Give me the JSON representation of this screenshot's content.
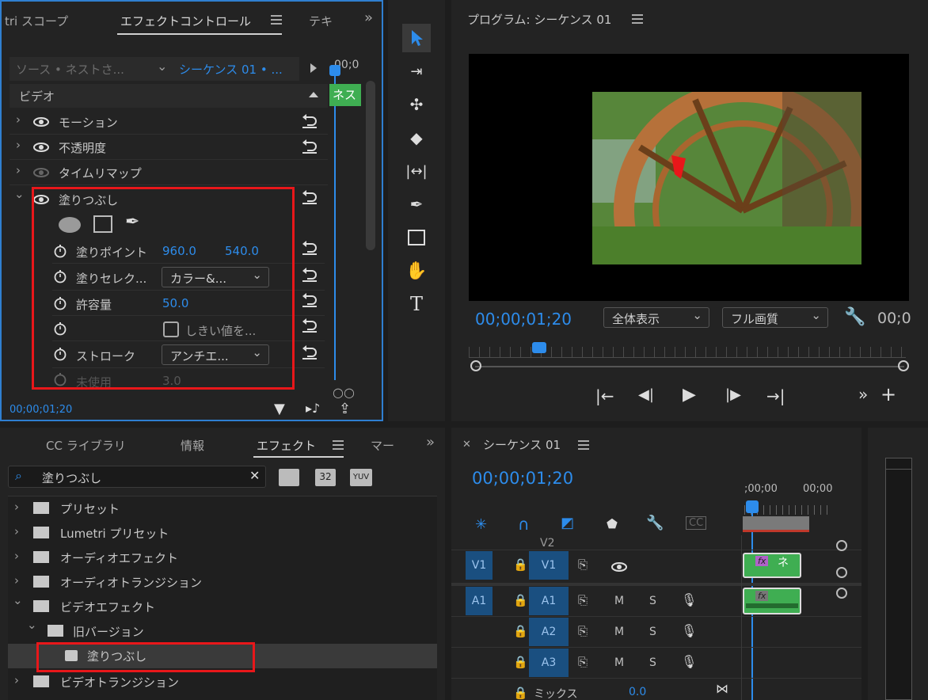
{
  "effect_panel": {
    "tabs": [
      "tri スコープ",
      "エフェクトコントロール",
      "テキ"
    ],
    "source_label": "ソース • ネストさ...",
    "sequence_label": "シーケンス 01 • ...",
    "timecode_head": "00;0",
    "clip_label": "ネス",
    "section_video": "ビデオ",
    "effects": [
      {
        "label": "モーション"
      },
      {
        "label": "不透明度"
      },
      {
        "label": "タイムリマップ"
      },
      {
        "label": "塗りつぶし"
      }
    ],
    "params": {
      "fill_point": {
        "label": "塗りポイント",
        "x": "960.0",
        "y": "540.0"
      },
      "fill_selector": {
        "label": "塗りセレク...",
        "value": "カラー&..."
      },
      "tolerance": {
        "label": "許容量",
        "value": "50.0"
      },
      "threshold": {
        "label": "しきい値を..."
      },
      "stroke": {
        "label": "ストローク",
        "value": "アンチエ..."
      },
      "unused": {
        "label": "未使用",
        "value": "3.0"
      }
    },
    "timecode": "00;00;01;20"
  },
  "program_monitor": {
    "title": "プログラム: シーケンス 01",
    "timecode": "00;00;01;20",
    "zoom": "全体表示",
    "quality": "フル画質",
    "timecode_right": "00;0"
  },
  "effects_browser": {
    "tabs": [
      "CC ライブラリ",
      "情報",
      "エフェクト",
      "マー"
    ],
    "search_value": "塗りつぶし",
    "badges": [
      "32",
      "YUV"
    ],
    "tree": [
      {
        "label": "プリセット",
        "depth": 0,
        "expanded": false
      },
      {
        "label": "Lumetri プリセット",
        "depth": 0,
        "expanded": false
      },
      {
        "label": "オーディオエフェクト",
        "depth": 0,
        "expanded": false
      },
      {
        "label": "オーディオトランジション",
        "depth": 0,
        "expanded": false
      },
      {
        "label": "ビデオエフェクト",
        "depth": 0,
        "expanded": true
      },
      {
        "label": "旧バージョン",
        "depth": 1,
        "expanded": true
      },
      {
        "label": "塗りつぶし",
        "depth": 2,
        "selected": true
      },
      {
        "label": "ビデオトランジション",
        "depth": 0,
        "expanded": false
      }
    ]
  },
  "timeline": {
    "title": "シーケンス 01",
    "timecode": "00;00;01;20",
    "ruler_labels": [
      ";00;00",
      "00;00"
    ],
    "tracks": {
      "v2": "V2",
      "v1_src": "V1",
      "v1": "V1",
      "a1_src": "A1",
      "a1": "A1",
      "a2": "A2",
      "a3": "A3"
    },
    "m": "M",
    "s": "S",
    "mix_label": "ミックス",
    "mix_value": "0.0",
    "clip_label": "ネ",
    "fx_badge": "fx"
  },
  "colors": {
    "accent_blue": "#2d8ceb",
    "highlight_red": "#e8171a",
    "clip_green": "#3fae52",
    "panel_bg": "#232323"
  }
}
